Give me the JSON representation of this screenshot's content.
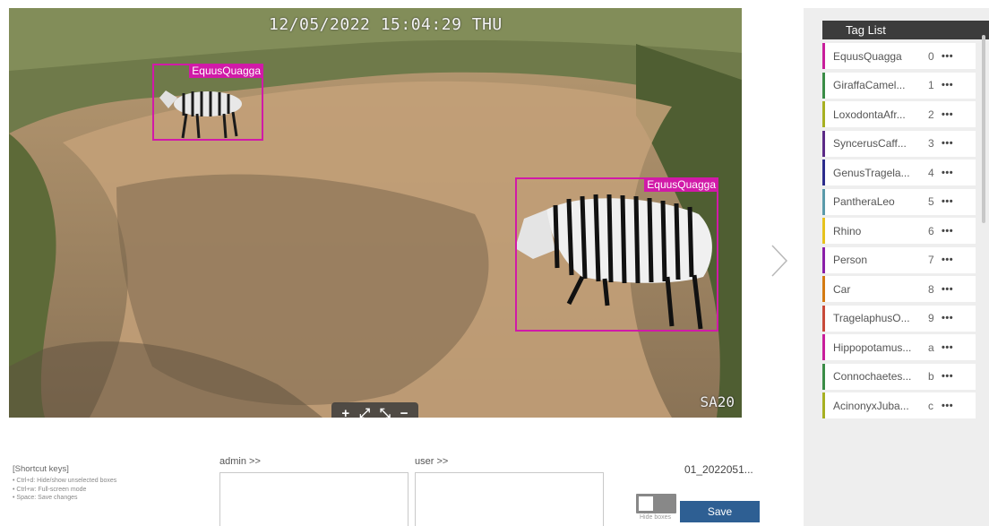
{
  "camera": {
    "timestamp": "12/05/2022 15:04:29 THU",
    "watermark": "SA20"
  },
  "detections": [
    {
      "label": "EquusQuagga",
      "color": "#d11aa8"
    },
    {
      "label": "EquusQuagga",
      "color": "#d11aa8"
    }
  ],
  "zoom_controls": {
    "zoom_in": "+",
    "expand": "⤢",
    "fit": "⤡",
    "zoom_out": "−"
  },
  "tag_list": {
    "title": "Tag List",
    "more_label": "•••",
    "items": [
      {
        "name": "EquusQuagga",
        "key": "0",
        "color": "#c81e9b"
      },
      {
        "name": "GiraffaCamel...",
        "key": "1",
        "color": "#3a8c46"
      },
      {
        "name": "LoxodontaAfr...",
        "key": "2",
        "color": "#a7b022"
      },
      {
        "name": "SyncerusCaff...",
        "key": "3",
        "color": "#5b2a86"
      },
      {
        "name": "GenusTragela...",
        "key": "4",
        "color": "#2c2c8c"
      },
      {
        "name": "PantheraLeo",
        "key": "5",
        "color": "#5a9aaa"
      },
      {
        "name": "Rhino",
        "key": "6",
        "color": "#e6c21e"
      },
      {
        "name": "Person",
        "key": "7",
        "color": "#8a1fa8"
      },
      {
        "name": "Car",
        "key": "8",
        "color": "#d47a12"
      },
      {
        "name": "TragelaphusO...",
        "key": "9",
        "color": "#c84a3a"
      },
      {
        "name": "Hippopotamus...",
        "key": "a",
        "color": "#c81e9b"
      },
      {
        "name": "Connochaetes...",
        "key": "b",
        "color": "#3a8c46"
      },
      {
        "name": "AcinonyxJuba...",
        "key": "c",
        "color": "#a7b022"
      }
    ]
  },
  "shortcuts": {
    "title": "[Shortcut keys]",
    "items": [
      "Ctrl+d: Hide/show unselected boxes",
      "Ctrl+w: Full-screen mode",
      "Space: Save changes"
    ]
  },
  "comments": {
    "admin_label": "admin >>",
    "user_label": "user >>",
    "admin_value": "",
    "user_value": ""
  },
  "filename": "01_2022051...",
  "hide_boxes_label": "Hide boxes",
  "save_label": "Save"
}
